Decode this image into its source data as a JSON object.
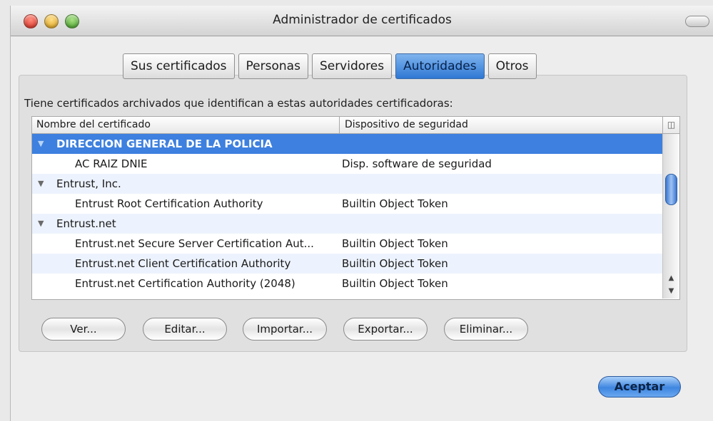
{
  "window": {
    "title": "Administrador de certificados"
  },
  "tabs": [
    {
      "label": "Sus certificados",
      "active": false
    },
    {
      "label": "Personas",
      "active": false
    },
    {
      "label": "Servidores",
      "active": false
    },
    {
      "label": "Autoridades",
      "active": true
    },
    {
      "label": "Otros",
      "active": false
    }
  ],
  "intro": "Tiene certificados archivados que identifican a estas autoridades certificadoras:",
  "table": {
    "columns": [
      "Nombre del certificado",
      "Dispositivo de seguridad"
    ],
    "rows": [
      {
        "name": "DIRECCION GENERAL DE LA POLICIA",
        "device": "",
        "group": true,
        "selected": true
      },
      {
        "name": "AC RAIZ DNIE",
        "device": "Disp. software de seguridad",
        "group": false
      },
      {
        "name": "Entrust, Inc.",
        "device": "",
        "group": true
      },
      {
        "name": "Entrust Root Certification Authority",
        "device": "Builtin Object Token",
        "group": false
      },
      {
        "name": "Entrust.net",
        "device": "",
        "group": true
      },
      {
        "name": "Entrust.net Secure Server Certification Aut...",
        "device": "Builtin Object Token",
        "group": false
      },
      {
        "name": "Entrust.net Client Certification Authority",
        "device": "Builtin Object Token",
        "group": false
      },
      {
        "name": "Entrust.net Certification Authority (2048)",
        "device": "Builtin Object Token",
        "group": false
      }
    ]
  },
  "buttons": {
    "view": "Ver...",
    "edit": "Editar...",
    "import": "Importar...",
    "export": "Exportar...",
    "delete": "Eliminar...",
    "accept": "Aceptar"
  },
  "colors": {
    "selection": "#3d80df",
    "accent": "#2f78d4"
  }
}
